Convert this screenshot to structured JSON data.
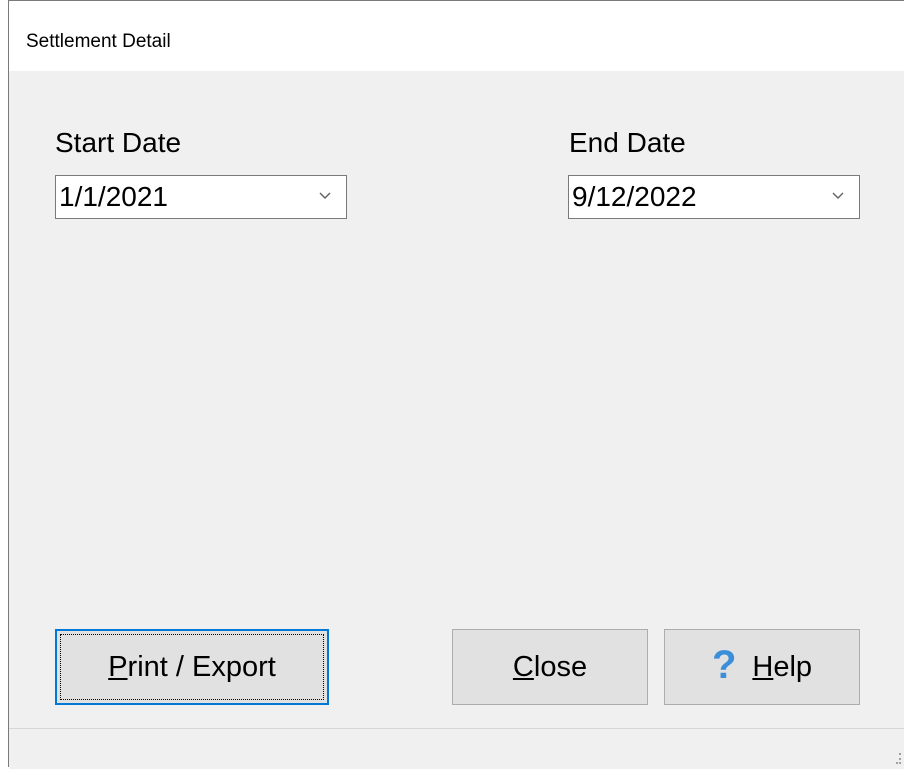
{
  "window": {
    "title": "Settlement Detail"
  },
  "start_date": {
    "label": "Start Date",
    "value": "1/1/2021"
  },
  "end_date": {
    "label": "End Date",
    "value": "9/12/2022"
  },
  "buttons": {
    "print_export": {
      "mnemonic": "P",
      "rest": "rint / Export"
    },
    "close": {
      "mnemonic": "C",
      "rest": "lose"
    },
    "help": {
      "icon": "?",
      "mnemonic": "H",
      "rest": "elp"
    }
  },
  "icons": {
    "dropdown": "chevron-down-icon",
    "help": "question-mark-icon",
    "resize": "resize-grip-icon"
  },
  "colors": {
    "accent": "#0078d7",
    "help_icon": "#3b8fd9",
    "window_bg": "#f0f0f0",
    "button_bg": "#e1e1e1"
  }
}
